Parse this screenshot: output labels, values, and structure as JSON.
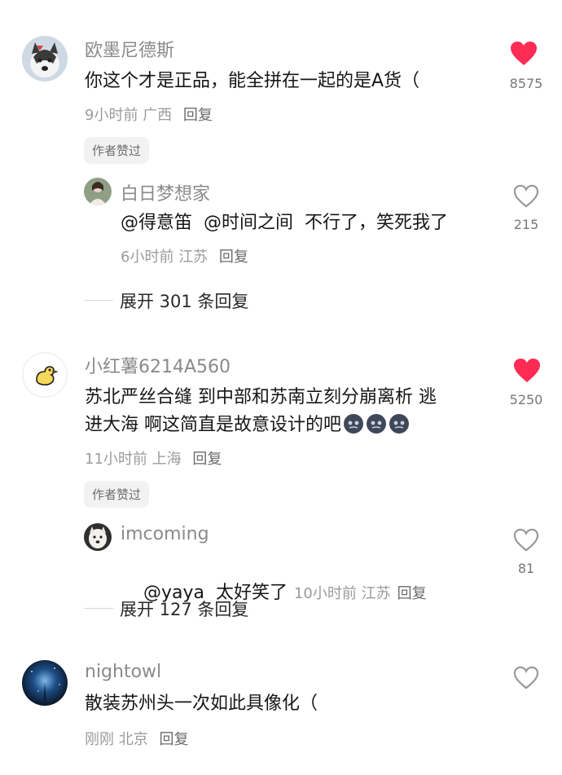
{
  "colors": {
    "like_active": "#fe2c55",
    "like_inactive": "#9a9a9a"
  },
  "comments": [
    {
      "user": "欧墨尼德斯",
      "text": "你这个才是正品，能全拼在一起的是A货（",
      "time": "9小时前",
      "location": "广西",
      "reply_label": "回复",
      "badge": "作者赞过",
      "likes": "8575",
      "liked": true,
      "avatar_icon": "husky-avatar-icon",
      "replies": [
        {
          "user": "白日梦想家",
          "text": "@得意笛  @时间之间  不行了，笑死我了",
          "time": "6小时前",
          "location": "江苏",
          "reply_label": "回复",
          "likes": "215",
          "liked": false
        }
      ],
      "expand": "展开 301 条回复"
    },
    {
      "user": "小红薯6214A560",
      "text_line1": "苏北严丝合缝 到中部和苏南立刻分崩离析 逃",
      "text_line2": "进大海 啊这简直是故意设计的吧",
      "time": "11小时前",
      "location": "上海",
      "reply_label": "回复",
      "badge": "作者赞过",
      "likes": "5250",
      "liked": true,
      "avatar_icon": "duck-avatar-icon",
      "replies": [
        {
          "user": "imcoming",
          "text": "@yaya  太好笑了",
          "time": "10小时前",
          "location": "江苏",
          "reply_label": "回复",
          "likes": "81",
          "liked": false
        }
      ],
      "expand": "展开 127 条回复"
    },
    {
      "user": "nightowl",
      "text": "散装苏州头一次如此具像化（",
      "time": "刚刚",
      "location": "北京",
      "reply_label": "回复",
      "liked": false,
      "avatar_icon": "night-sky-avatar-icon"
    }
  ]
}
